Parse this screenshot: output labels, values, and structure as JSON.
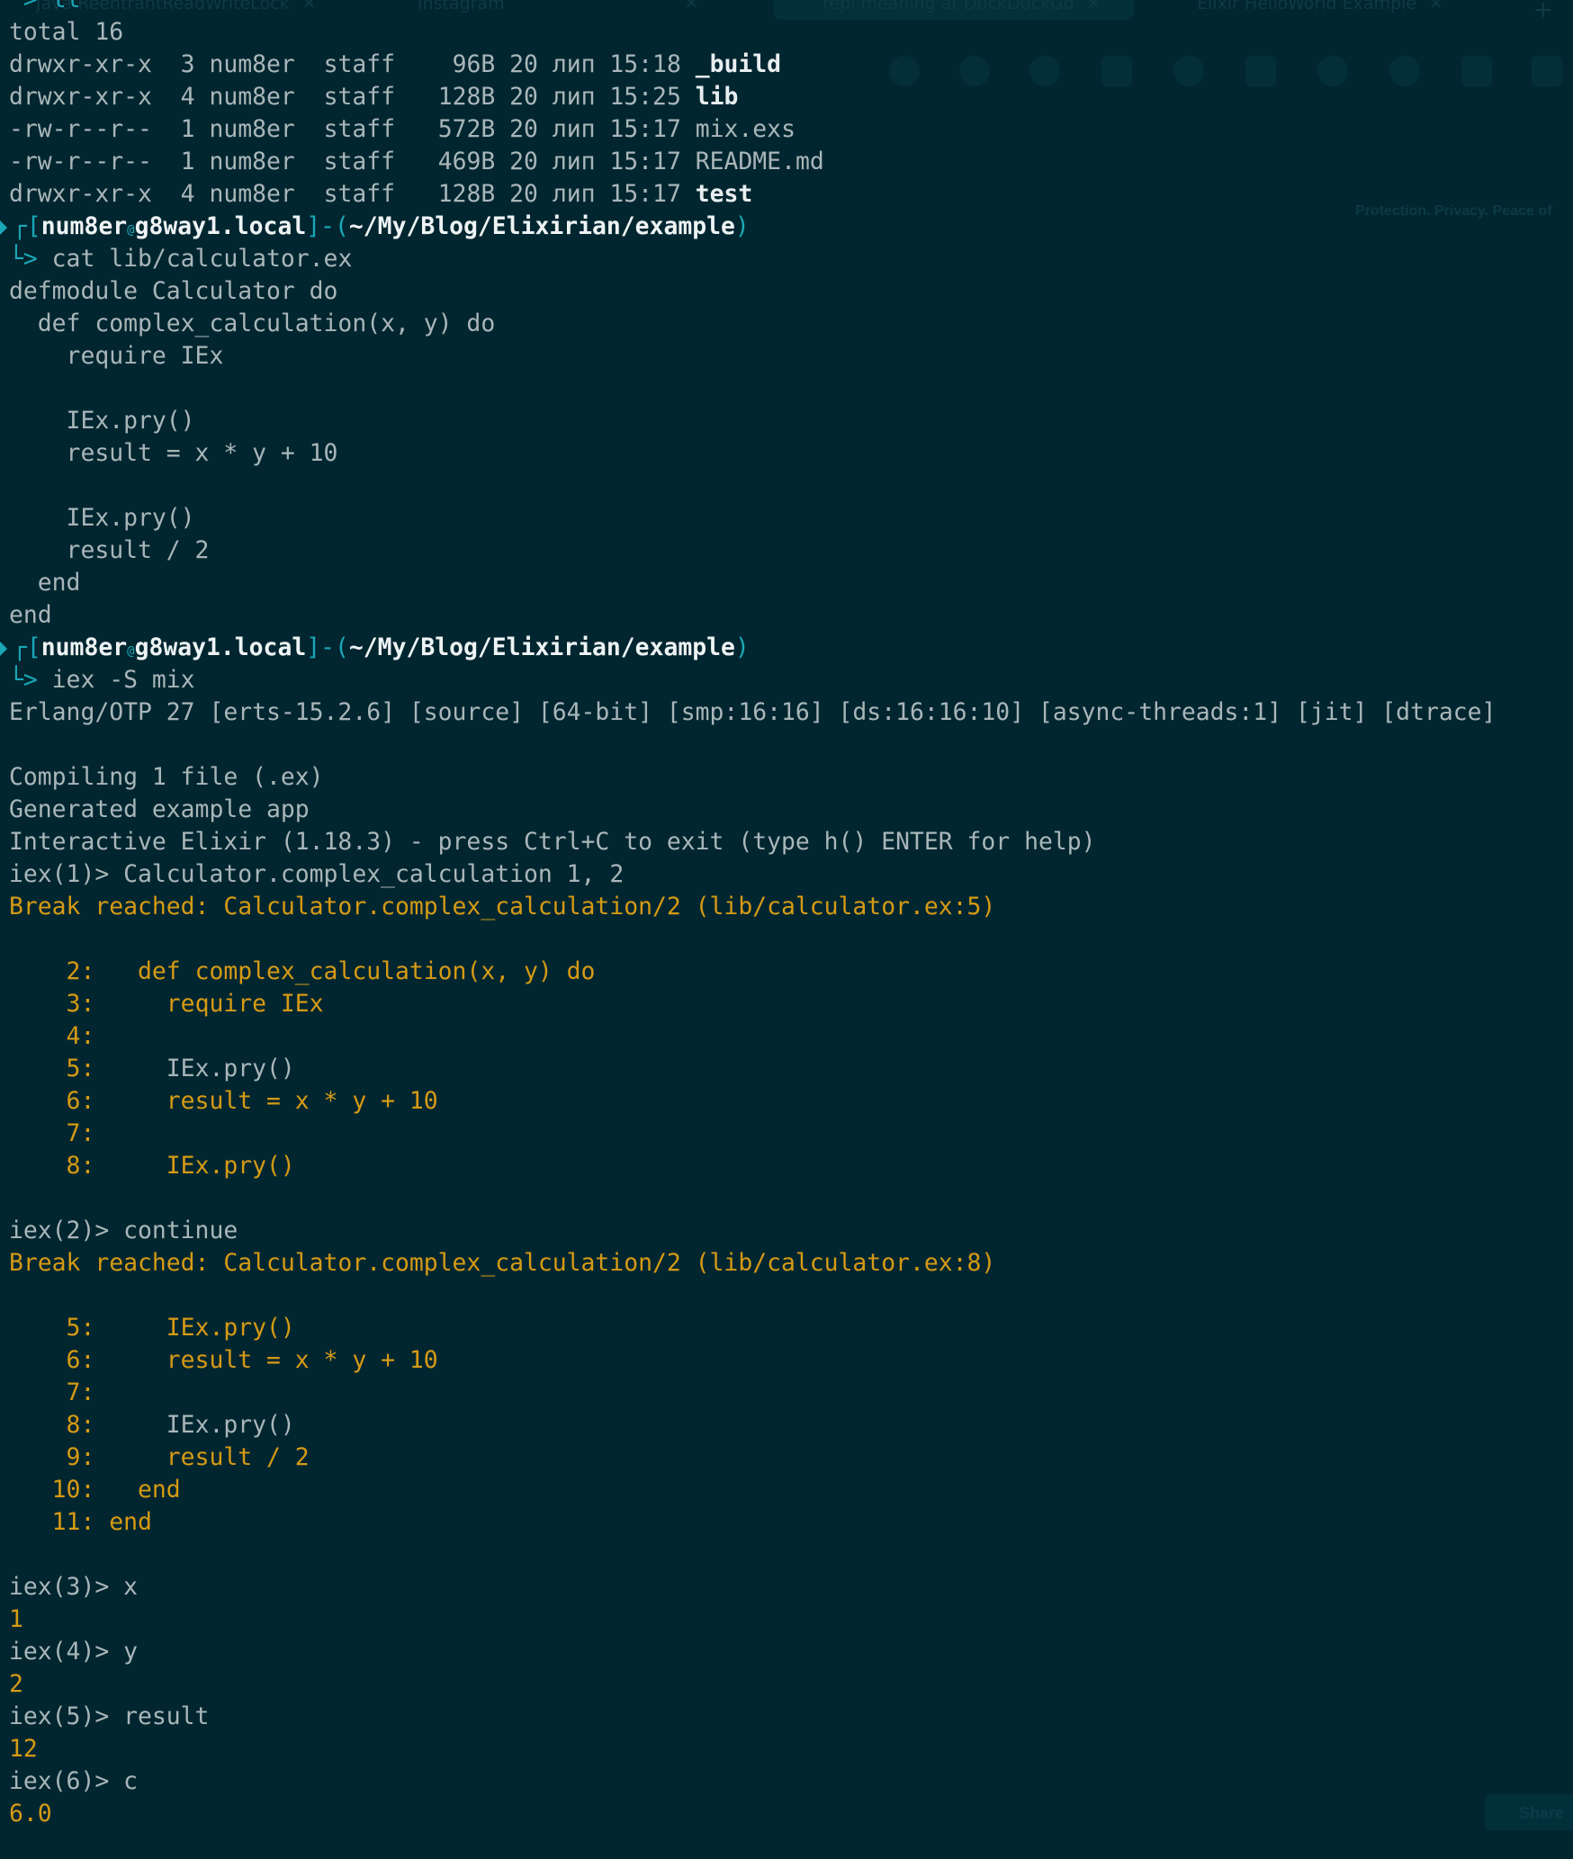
{
  "background_tabs": [
    {
      "title": "Java ReentrantReadWriteLock",
      "close": "✕"
    },
    {
      "title": "Instagram",
      "close": "✕"
    },
    {
      "title": "repl meaning at DuckDuckGo",
      "close": "✕"
    },
    {
      "title": "Elixir HelloWorld Example",
      "close": "✕"
    }
  ],
  "background_tab_plus": "+",
  "background_tagline": "Protection. Privacy. Peace of",
  "background_share": "Share",
  "terminal": {
    "top_cmd": "└> ll",
    "total": "total 16",
    "listing": [
      {
        "perms": "drwxr-xr-x",
        "links": "3",
        "user": "num8er",
        "group": "staff",
        "size": "96B",
        "day": "20",
        "month": "лип",
        "time": "15:18",
        "name": "_build",
        "is_dir": true
      },
      {
        "perms": "drwxr-xr-x",
        "links": "4",
        "user": "num8er",
        "group": "staff",
        "size": "128B",
        "day": "20",
        "month": "лип",
        "time": "15:25",
        "name": "lib",
        "is_dir": true
      },
      {
        "perms": "-rw-r--r--",
        "links": "1",
        "user": "num8er",
        "group": "staff",
        "size": "572B",
        "day": "20",
        "month": "лип",
        "time": "15:17",
        "name": "mix.exs",
        "is_dir": false
      },
      {
        "perms": "-rw-r--r--",
        "links": "1",
        "user": "num8er",
        "group": "staff",
        "size": "469B",
        "day": "20",
        "month": "лип",
        "time": "15:17",
        "name": "README.md",
        "is_dir": false
      },
      {
        "perms": "drwxr-xr-x",
        "links": "4",
        "user": "num8er",
        "group": "staff",
        "size": "128B",
        "day": "20",
        "month": "лип",
        "time": "15:17",
        "name": "test",
        "is_dir": true
      }
    ],
    "prompt": {
      "user": "num8er",
      "at": "@",
      "host": "g8way1.local",
      "path": "~/My/Blog/Elixirian/example"
    },
    "cmd_cat": "cat lib/calculator.ex",
    "source": [
      "defmodule Calculator do",
      "  def complex_calculation(x, y) do",
      "    require IEx",
      "",
      "    IEx.pry()",
      "    result = x * y + 10",
      "",
      "    IEx.pry()",
      "    result / 2",
      "  end",
      "end"
    ],
    "cmd_iex": "iex -S mix",
    "erlang_banner": "Erlang/OTP 27 [erts-15.2.6] [source] [64-bit] [smp:16:16] [ds:16:16:10] [async-threads:1] [jit] [dtrace]",
    "compile_lines": [
      "Compiling 1 file (.ex)",
      "Generated example app",
      "Interactive Elixir (1.18.3) - press Ctrl+C to exit (type h() ENTER for help)"
    ],
    "iex1": "iex(1)> Calculator.complex_calculation 1, 2",
    "break1": "Break reached: Calculator.complex_calculation/2 (lib/calculator.ex:5)",
    "break1_lines": [
      {
        "num": "    2:",
        "code": "   def complex_calculation(x, y) do",
        "hl": true
      },
      {
        "num": "    3:",
        "code": "     require IEx",
        "hl": true
      },
      {
        "num": "    4:",
        "code": "",
        "hl": true
      },
      {
        "num": "    5:",
        "code": "     IEx.pry()",
        "hl": false
      },
      {
        "num": "    6:",
        "code": "     result = x * y + 10",
        "hl": true
      },
      {
        "num": "    7:",
        "code": "",
        "hl": true
      },
      {
        "num": "    8:",
        "code": "     IEx.pry()",
        "hl": true
      }
    ],
    "iex2": "iex(2)> continue",
    "break2": "Break reached: Calculator.complex_calculation/2 (lib/calculator.ex:8)",
    "break2_lines": [
      {
        "num": "    5:",
        "code": "     IEx.pry()",
        "hl": true
      },
      {
        "num": "    6:",
        "code": "     result = x * y + 10",
        "hl": true
      },
      {
        "num": "    7:",
        "code": "",
        "hl": true
      },
      {
        "num": "    8:",
        "code": "     IEx.pry()",
        "hl": false
      },
      {
        "num": "    9:",
        "code": "     result / 2",
        "hl": true
      },
      {
        "num": "   10:",
        "code": "   end",
        "hl": true
      },
      {
        "num": "   11:",
        "code": " end",
        "hl": true
      }
    ],
    "session": [
      {
        "prompt": "iex(3)> x",
        "out": "1"
      },
      {
        "prompt": "iex(4)> y",
        "out": "2"
      },
      {
        "prompt": "iex(5)> result",
        "out": "12"
      },
      {
        "prompt": "iex(6)> c",
        "out": "6.0"
      }
    ]
  },
  "colors": {
    "background": "#012630",
    "text": "#a9b6b9",
    "accent_yellow": "#d69a14",
    "prompt_cyan": "#1aa8b8"
  }
}
